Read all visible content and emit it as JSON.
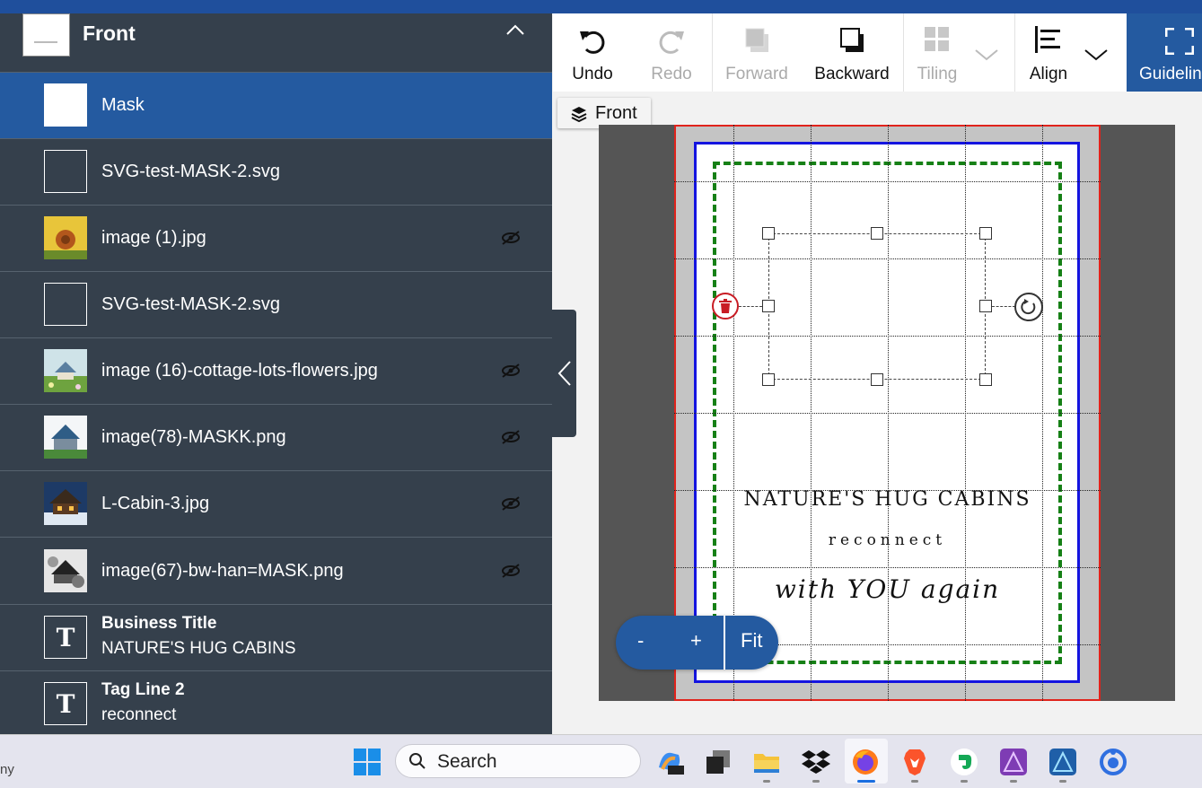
{
  "panel": {
    "section_title": "Front",
    "layers": [
      {
        "label": "Mask",
        "thumb": "white",
        "selected": true,
        "hidden": false
      },
      {
        "label": "SVG-test-MASK-2.svg",
        "thumb": "empty",
        "selected": false,
        "hidden": false
      },
      {
        "label": "image (1).jpg",
        "thumb": "yellow-flower-image",
        "selected": false,
        "hidden": true
      },
      {
        "label": "SVG-test-MASK-2.svg",
        "thumb": "empty",
        "selected": false,
        "hidden": false
      },
      {
        "label": "image (16)-cottage-lots-flowers.jpg",
        "thumb": "cottage-image",
        "selected": false,
        "hidden": true
      },
      {
        "label": "image(78)-MASKK.png",
        "thumb": "cottage-blue-image",
        "selected": false,
        "hidden": true
      },
      {
        "label": "L-Cabin-3.jpg",
        "thumb": "cabin-night-image",
        "selected": false,
        "hidden": true
      },
      {
        "label": "image(67)-bw-han=MASK.png",
        "thumb": "bw-image",
        "selected": false,
        "hidden": true
      }
    ],
    "text_layers": [
      {
        "glyph": "T",
        "name": "Business Title",
        "value": "NATURE'S HUG CABINS"
      },
      {
        "glyph": "T",
        "name": "Tag Line 2",
        "value": "reconnect"
      }
    ]
  },
  "toolbar": {
    "undo": "Undo",
    "redo": "Redo",
    "forward": "Forward",
    "backward": "Backward",
    "tiling": "Tiling",
    "align": "Align",
    "guidelines": "Guidelines"
  },
  "canvas": {
    "side_chip": "Front",
    "title_text": "NATURE'S HUG CABINS",
    "tagline_text": "reconnect",
    "script_text": "with YOU again"
  },
  "zoom": {
    "minus": "-",
    "plus": "+",
    "fit": "Fit"
  },
  "taskbar": {
    "left_text": "ny",
    "search_placeholder": "Search",
    "apps": [
      "windows-start-icon",
      "copilot-icon",
      "task-view-icon",
      "file-explorer-icon",
      "dropbox-icon",
      "firefox-icon",
      "brave-icon",
      "evernote-icon",
      "affinity-photo-icon",
      "affinity-designer-icon",
      "app-circle-icon"
    ]
  },
  "colors": {
    "panel_bg": "#35404c",
    "selected_row": "#245aa0",
    "accent_blue": "#245aa0",
    "bleed_red": "#e0231c",
    "trim_blue": "#1414e0",
    "safe_green": "#168016"
  }
}
